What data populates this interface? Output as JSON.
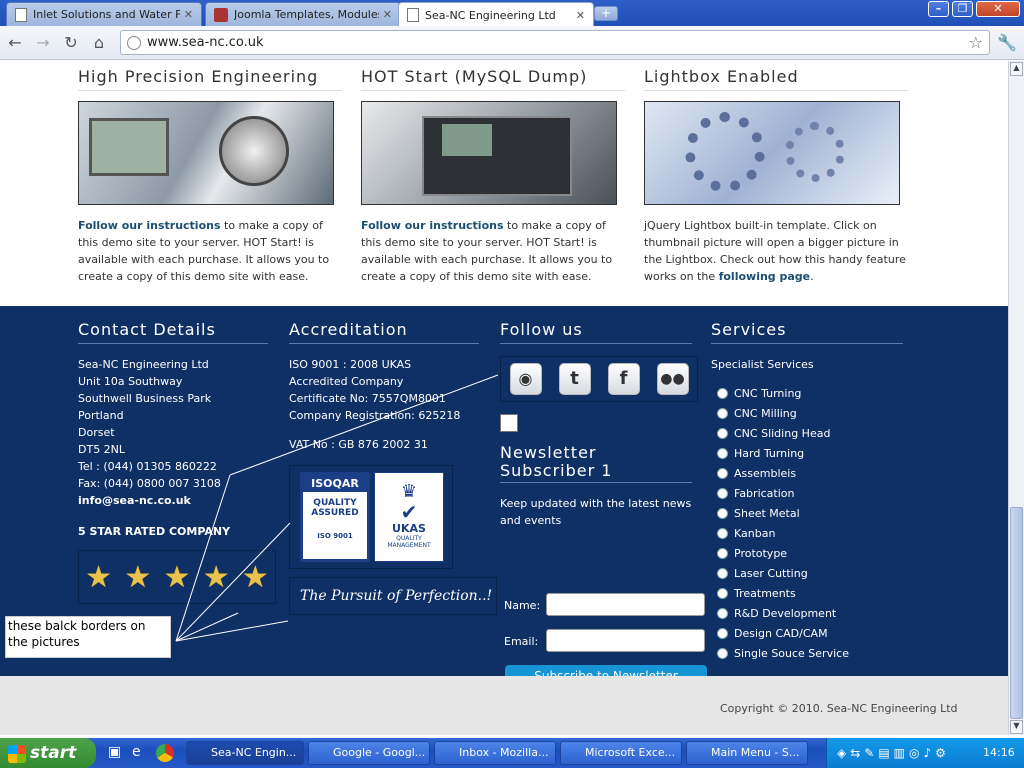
{
  "browser": {
    "tabs": [
      {
        "title": "Inlet Solutions and Water F...",
        "active": false
      },
      {
        "title": "Joomla Templates, Modules...",
        "active": false
      },
      {
        "title": "Sea-NC Engineering Ltd",
        "active": true
      }
    ],
    "new_tab_label": "+",
    "url": "www.sea-nc.co.uk",
    "window_controls": {
      "minimize": "–",
      "restore": "❐",
      "close": "✕"
    }
  },
  "features": [
    {
      "heading": "High Precision Engineering",
      "link": "Follow our instructions",
      "text": " to make a copy of this demo site to your server. HOT Start! is available with each purchase. It allows you to create a copy of this demo site with ease."
    },
    {
      "heading": "HOT Start (MySQL Dump)",
      "link": "Follow our instructions",
      "text": " to make a copy of this demo site to your server. HOT Start! is available with each purchase. It allows you to create a copy of this demo site with ease."
    },
    {
      "heading": "Lightbox Enabled",
      "text": "jQuery Lightbox built-in template. Click on thumbnail picture will open a bigger picture in the Lightbox. Check out how this handy feature works on the ",
      "link": "following page",
      "after": "."
    }
  ],
  "contact": {
    "heading": "Contact Details",
    "lines": [
      "Sea-NC Engineering Ltd",
      "Unit 10a Southway",
      "Southwell Business Park",
      "Portland",
      "Dorset",
      "DT5 2NL",
      "Tel : (044) 01305 860222",
      "Fax: (044) 0800 007 3108"
    ],
    "email": "info@sea-nc.co.uk",
    "rating_label": "5 STAR RATED COMPANY",
    "stars": 5
  },
  "accreditation": {
    "heading": "Accreditation",
    "lines": [
      "ISO 9001 : 2008 UKAS",
      "Accredited Company",
      "Certificate No: 7557QM8001",
      "Company  Registration: 625218"
    ],
    "vat": "VAT No : GB 876 2002 31",
    "isoqar": {
      "name": "ISOQAR",
      "line1": "QUALITY",
      "line2": "ASSURED",
      "std": "ISO 9001"
    },
    "ukas": {
      "name": "UKAS",
      "sub1": "QUALITY",
      "sub2": "MANAGEMENT"
    },
    "slogan": "The Pursuit of Perfection..!"
  },
  "follow": {
    "heading": "Follow us",
    "icons": [
      "rss-icon",
      "twitter-icon",
      "facebook-icon",
      "flickr-icon"
    ],
    "newsletter_heading_1": "Newsletter",
    "newsletter_heading_2": "Subscriber 1",
    "newsletter_text": "Keep updated with the latest news and events",
    "name_label": "Name:",
    "email_label": "Email:",
    "name_value": "",
    "email_value": "",
    "subscribe_button": "Subscribe to Newsletter"
  },
  "services": {
    "heading": "Services",
    "subheading": "Specialist Services",
    "items": [
      "CNC Turning",
      "CNC Milling",
      "CNC Sliding Head",
      "Hard Turning",
      "Assembleis",
      "Fabrication",
      "Sheet Metal",
      "Kanban",
      "Prototype",
      "Laser Cutting",
      "Treatments",
      "R&D Development",
      "Design CAD/CAM",
      "Single Souce Service"
    ]
  },
  "copyright": "Copyright © 2010. Sea-NC Engineering Ltd",
  "annotation": "these balck borders on the pictures",
  "taskbar": {
    "start": "start",
    "buttons": [
      {
        "label": "Sea-NC Engin...",
        "active": true
      },
      {
        "label": "Google - Googl...",
        "active": false
      },
      {
        "label": "Inbox - Mozilla...",
        "active": false
      },
      {
        "label": "Microsoft Exce...",
        "active": false
      },
      {
        "label": "Main Menu - S...",
        "active": false
      }
    ],
    "clock": "14:16"
  }
}
